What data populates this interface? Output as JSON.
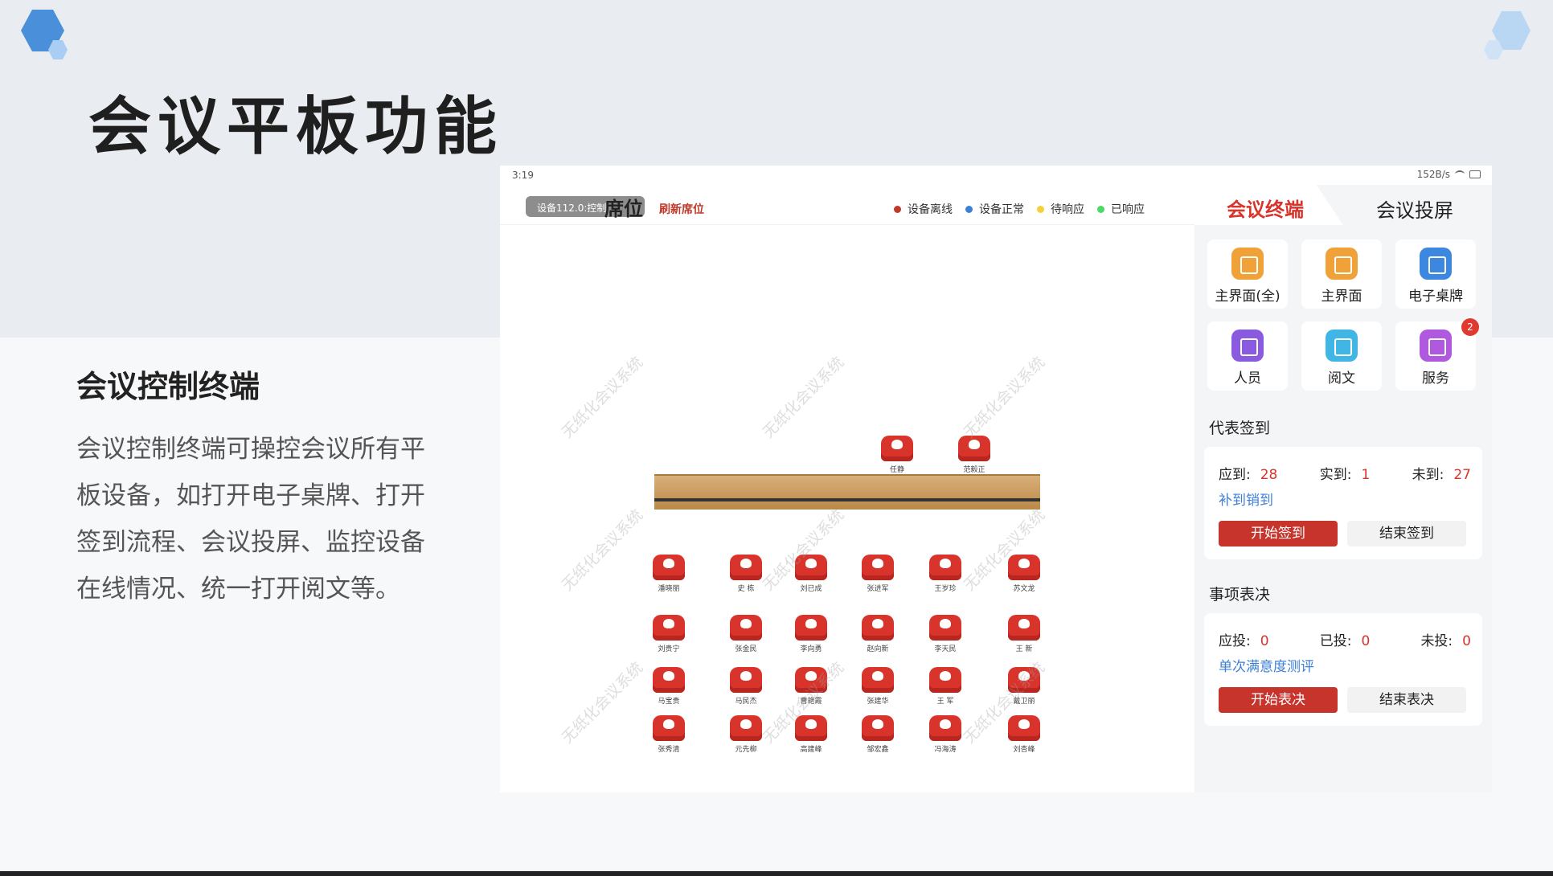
{
  "slide": {
    "title": "会议平板功能",
    "left_heading": "会议控制终端",
    "left_description": "会议控制终端可操控会议所有平板设备，如打开电子桌牌、打开签到流程、会议投屏、监控设备在线情况、统一打开阅文等。"
  },
  "tablet": {
    "status_time": "3:19",
    "status_speed": "152B/s",
    "device_chip": "设备112.0:控制",
    "pane_title": "席位",
    "refresh_label": "刷新席位",
    "legend": [
      {
        "label": "设备离线",
        "color": "#c0392b"
      },
      {
        "label": "设备正常",
        "color": "#3d7fd6"
      },
      {
        "label": "待响应",
        "color": "#f1d23b"
      },
      {
        "label": "已响应",
        "color": "#4cd964"
      }
    ],
    "watermark": "无纸化会议系统",
    "podium_seats": [
      "任静",
      "范毅正"
    ],
    "seat_rows": [
      [
        "潘晓丽",
        "史 栋",
        "刘已成",
        "张进军",
        "王岁珍",
        "苏文龙"
      ],
      [
        "刘贵宁",
        "张金民",
        "李向勇",
        "赵向新",
        "李天民",
        "王 新"
      ],
      [
        "马宝贵",
        "马民杰",
        "曹艳霞",
        "张建华",
        "王 军",
        "戴卫丽"
      ],
      [
        "张秀清",
        "元先柳",
        "高建峰",
        "邹宏鑫",
        "冯海涛",
        "刘杏峰"
      ]
    ]
  },
  "right_panel": {
    "tab_active": "会议终端",
    "tab_other": "会议投屏",
    "tiles": [
      {
        "label": "主界面(全)",
        "icon": "window-icon",
        "color": "#f0a137"
      },
      {
        "label": "主界面",
        "icon": "window-icon",
        "color": "#f0a137"
      },
      {
        "label": "电子桌牌",
        "icon": "monitor-icon",
        "color": "#3c87e0"
      },
      {
        "label": "人员",
        "icon": "people-icon",
        "color": "#8a5be0"
      },
      {
        "label": "阅文",
        "icon": "document-icon",
        "color": "#3fb6e6"
      },
      {
        "label": "服务",
        "icon": "heart-icon",
        "color": "#b058e0",
        "badge": "2"
      }
    ],
    "signin": {
      "title": "代表签到",
      "expected_label": "应到:",
      "expected": "28",
      "actual_label": "实到:",
      "actual": "1",
      "absent_label": "未到:",
      "absent": "27",
      "link": "补到销到",
      "start": "开始签到",
      "end": "结束签到"
    },
    "vote": {
      "title": "事项表决",
      "expected_label": "应投:",
      "expected": "0",
      "cast_label": "已投:",
      "cast": "0",
      "pending_label": "未投:",
      "pending": "0",
      "link": "单次满意度测评",
      "start": "开始表决",
      "end": "结束表决"
    }
  }
}
